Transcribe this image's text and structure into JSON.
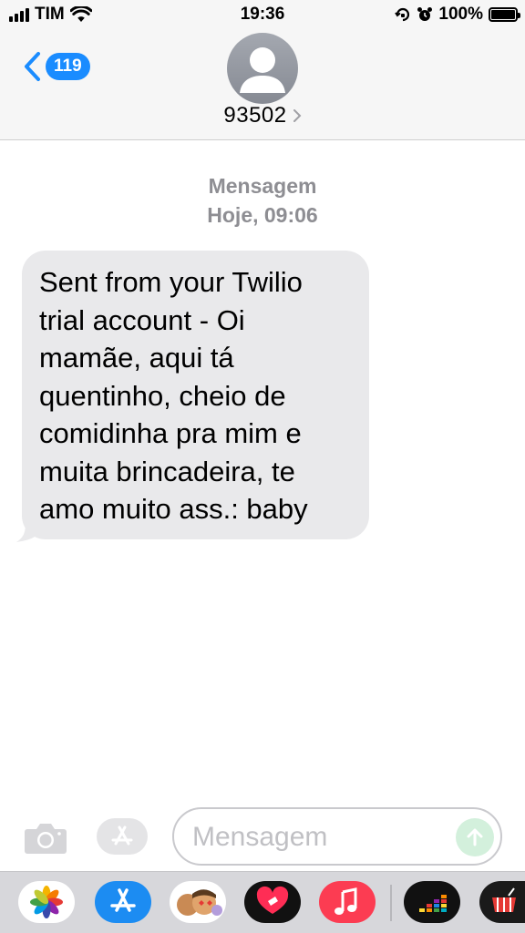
{
  "status_bar": {
    "carrier": "TIM",
    "time": "19:36",
    "battery": "100%"
  },
  "header": {
    "back_badge": "119",
    "contact_name": "93502"
  },
  "conversation": {
    "service_label": "Mensagem",
    "timestamp": "Hoje, 09:06",
    "messages": [
      {
        "direction": "incoming",
        "text": "Sent from your Twilio trial account - Oi mamãe, aqui tá quentinho, cheio de comidinha pra mim e muita brincadeira, te amo muito ass.: baby"
      }
    ]
  },
  "composer": {
    "placeholder": "Mensagem"
  },
  "app_drawer": {
    "apps": [
      "photos-icon",
      "app-store-icon",
      "memoji-icon",
      "digital-touch-icon",
      "music-icon",
      "deezer-icon",
      "shopping-icon"
    ]
  },
  "colors": {
    "accent": "#1a8cff",
    "bubble_incoming": "#e9e9eb",
    "bar_background": "#f6f6f6",
    "drawer_background": "#d7d7db"
  }
}
